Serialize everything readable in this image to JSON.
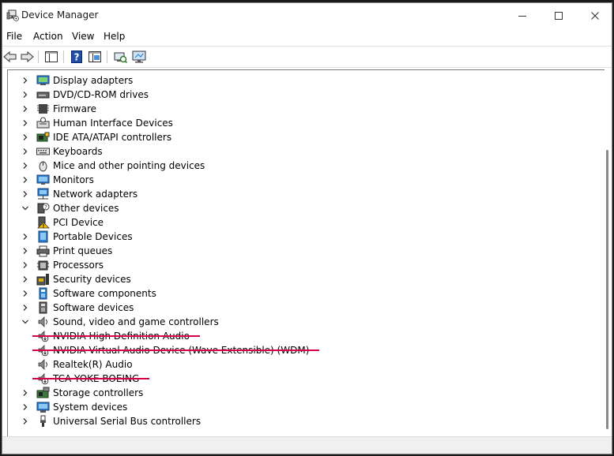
{
  "window": {
    "title": "Device Manager"
  },
  "menu": [
    "File",
    "Action",
    "View",
    "Help"
  ],
  "toolbar": [
    {
      "icon": "back-arrow-icon"
    },
    {
      "icon": "forward-arrow-icon"
    },
    {
      "icon": "show-hide-tree-icon"
    },
    {
      "icon": "help-icon"
    },
    {
      "icon": "properties-icon"
    },
    {
      "icon": "scan-hardware-icon"
    },
    {
      "icon": "monitor-icon"
    }
  ],
  "tree": [
    {
      "label": "Display adapters",
      "icon": "display-adapter-icon",
      "level": 0,
      "expanded": false,
      "disabled": false
    },
    {
      "label": "DVD/CD-ROM drives",
      "icon": "dvd-drive-icon",
      "level": 0,
      "expanded": false,
      "disabled": false
    },
    {
      "label": "Firmware",
      "icon": "firmware-icon",
      "level": 0,
      "expanded": false,
      "disabled": false
    },
    {
      "label": "Human Interface Devices",
      "icon": "hid-icon",
      "level": 0,
      "expanded": false,
      "disabled": false
    },
    {
      "label": "IDE ATA/ATAPI controllers",
      "icon": "ide-controller-icon",
      "level": 0,
      "expanded": false,
      "disabled": false
    },
    {
      "label": "Keyboards",
      "icon": "keyboard-icon",
      "level": 0,
      "expanded": false,
      "disabled": false
    },
    {
      "label": "Mice and other pointing devices",
      "icon": "mouse-icon",
      "level": 0,
      "expanded": false,
      "disabled": false
    },
    {
      "label": "Monitors",
      "icon": "monitor-icon",
      "level": 0,
      "expanded": false,
      "disabled": false
    },
    {
      "label": "Network adapters",
      "icon": "network-adapter-icon",
      "level": 0,
      "expanded": false,
      "disabled": false
    },
    {
      "label": "Other devices",
      "icon": "unknown-device-icon",
      "level": 0,
      "expanded": true,
      "disabled": false
    },
    {
      "label": "PCI Device",
      "icon": "warning-device-icon",
      "level": 1,
      "expanded": null,
      "disabled": false
    },
    {
      "label": "Portable Devices",
      "icon": "portable-device-icon",
      "level": 0,
      "expanded": false,
      "disabled": false
    },
    {
      "label": "Print queues",
      "icon": "printer-icon",
      "level": 0,
      "expanded": false,
      "disabled": false
    },
    {
      "label": "Processors",
      "icon": "processor-icon",
      "level": 0,
      "expanded": false,
      "disabled": false
    },
    {
      "label": "Security devices",
      "icon": "security-device-icon",
      "level": 0,
      "expanded": false,
      "disabled": false
    },
    {
      "label": "Software components",
      "icon": "software-component-icon",
      "level": 0,
      "expanded": false,
      "disabled": false
    },
    {
      "label": "Software devices",
      "icon": "software-device-icon",
      "level": 0,
      "expanded": false,
      "disabled": false
    },
    {
      "label": "Sound, video and game controllers",
      "icon": "speaker-icon",
      "level": 0,
      "expanded": true,
      "disabled": false
    },
    {
      "label": "NVIDIA High Definition Audio",
      "icon": "disabled-speaker-icon",
      "level": 1,
      "expanded": null,
      "disabled": true
    },
    {
      "label": "NVIDIA Virtual Audio Device (Wave Extensible) (WDM)",
      "icon": "disabled-speaker-icon",
      "level": 1,
      "expanded": null,
      "disabled": true
    },
    {
      "label": "Realtek(R) Audio",
      "icon": "speaker-icon",
      "level": 1,
      "expanded": null,
      "disabled": false
    },
    {
      "label": "TCA YOKE BOEING",
      "icon": "disabled-speaker-icon",
      "level": 1,
      "expanded": null,
      "disabled": true
    },
    {
      "label": "Storage controllers",
      "icon": "storage-controller-icon",
      "level": 0,
      "expanded": false,
      "disabled": false
    },
    {
      "label": "System devices",
      "icon": "system-device-icon",
      "level": 0,
      "expanded": false,
      "disabled": false
    },
    {
      "label": "Universal Serial Bus controllers",
      "icon": "usb-icon",
      "level": 0,
      "expanded": false,
      "disabled": false
    }
  ],
  "colors": {
    "strike": "#d6004a",
    "icon_blue": "#2f7fd0",
    "icon_gray": "#5a5a5a"
  }
}
